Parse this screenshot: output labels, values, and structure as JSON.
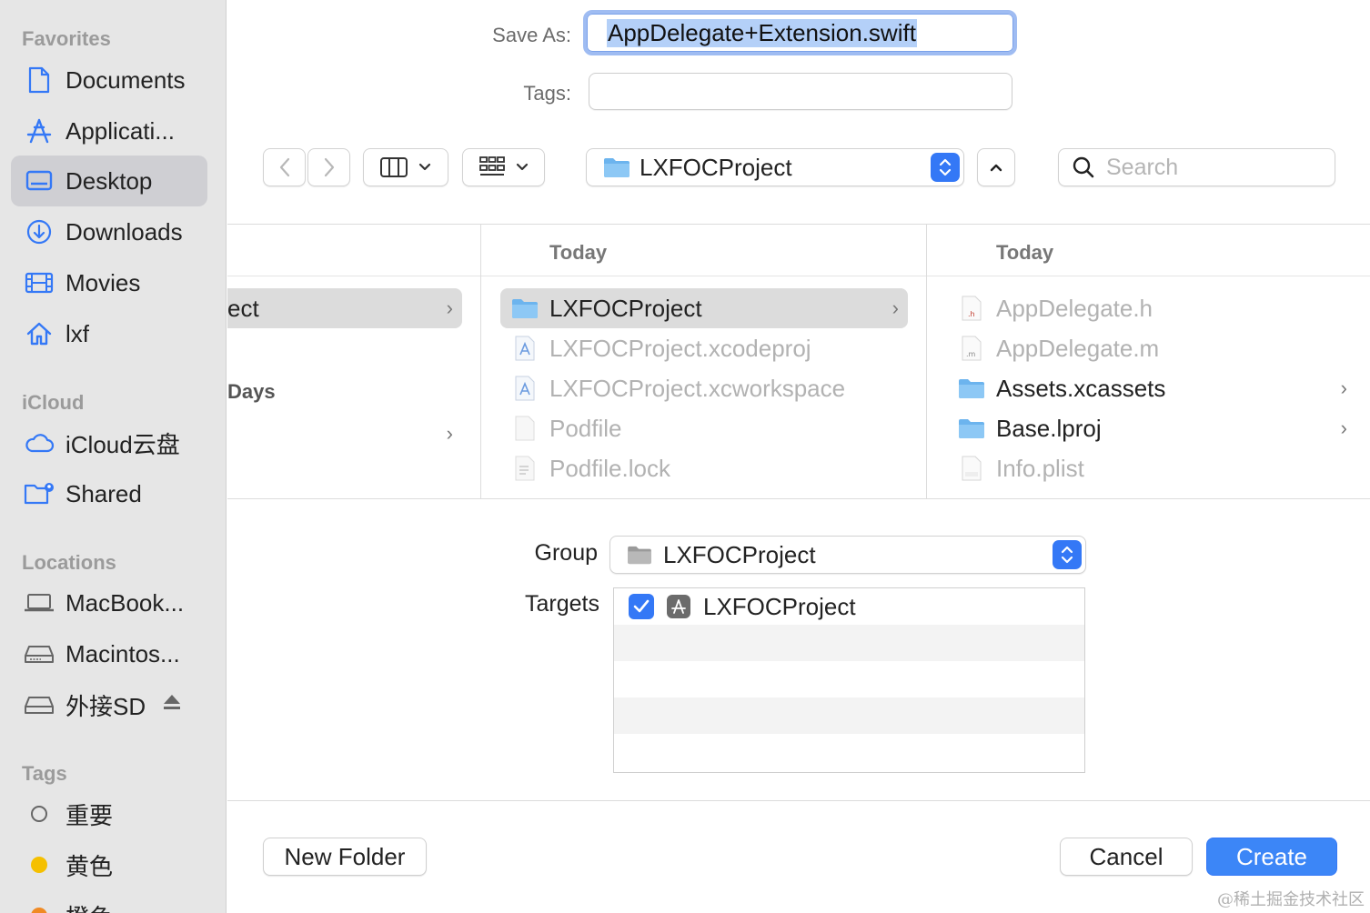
{
  "sidebar": {
    "favorites_heading": "Favorites",
    "favorites": [
      {
        "label": "Documents",
        "icon": "document-icon"
      },
      {
        "label": "Applicati...",
        "icon": "applications-icon"
      },
      {
        "label": "Desktop",
        "icon": "desktop-icon",
        "selected": true
      },
      {
        "label": "Downloads",
        "icon": "downloads-icon"
      },
      {
        "label": "Movies",
        "icon": "movies-icon"
      },
      {
        "label": "lxf",
        "icon": "home-icon"
      }
    ],
    "icloud_heading": "iCloud",
    "icloud": [
      {
        "label": "iCloud云盘",
        "icon": "cloud-icon"
      },
      {
        "label": "Shared",
        "icon": "shared-folder-icon"
      }
    ],
    "locations_heading": "Locations",
    "locations": [
      {
        "label": "MacBook...",
        "icon": "laptop-icon"
      },
      {
        "label": "Macintos...",
        "icon": "hard-drive-icon"
      },
      {
        "label": "外接SD",
        "icon": "external-drive-icon",
        "eject": true
      }
    ],
    "tags_heading": "Tags",
    "tags": [
      {
        "label": "重要",
        "color": "hollow"
      },
      {
        "label": "黄色",
        "color": "#f5c000"
      },
      {
        "label": "橙色",
        "color": "#f08a24"
      }
    ]
  },
  "form": {
    "save_as_label": "Save As:",
    "save_as_value": "AppDelegate+Extension.swift",
    "tags_label": "Tags:",
    "tags_value": ""
  },
  "toolbar": {
    "location": "LXFOCProject",
    "search_placeholder": "Search"
  },
  "browser": {
    "col1": {
      "rows": [
        {
          "label": "ect",
          "selected": true,
          "chevron": true
        },
        {
          "label": "Days",
          "bold": true
        },
        {
          "label": "",
          "chevron": true
        }
      ]
    },
    "col2": {
      "heading": "Today",
      "rows": [
        {
          "label": "LXFOCProject",
          "type": "folder",
          "selected": true,
          "chevron": true
        },
        {
          "label": "LXFOCProject.xcodeproj",
          "type": "xcodeproj",
          "dim": true
        },
        {
          "label": "LXFOCProject.xcworkspace",
          "type": "xcworkspace",
          "dim": true
        },
        {
          "label": "Podfile",
          "type": "file",
          "dim": true
        },
        {
          "label": "Podfile.lock",
          "type": "textfile",
          "dim": true
        }
      ]
    },
    "col3": {
      "heading": "Today",
      "rows": [
        {
          "label": "AppDelegate.h",
          "type": "h-file",
          "dim": true
        },
        {
          "label": "AppDelegate.m",
          "type": "m-file",
          "dim": true
        },
        {
          "label": "Assets.xcassets",
          "type": "folder",
          "chevron": true
        },
        {
          "label": "Base.lproj",
          "type": "folder",
          "chevron": true
        },
        {
          "label": "Info.plist",
          "type": "plist-file",
          "dim": true
        }
      ]
    }
  },
  "options": {
    "group_label": "Group",
    "group_value": "LXFOCProject",
    "targets_label": "Targets",
    "targets": [
      {
        "label": "LXFOCProject",
        "checked": true
      }
    ]
  },
  "footer": {
    "new_folder": "New Folder",
    "cancel": "Cancel",
    "create": "Create"
  },
  "watermark": "@稀土掘金技术社区",
  "colors": {
    "accent": "#3478f6",
    "sidebar_bg": "#e6e6e6",
    "selection": "#dcdcdc",
    "folder_blue": "#6cb4ee"
  }
}
